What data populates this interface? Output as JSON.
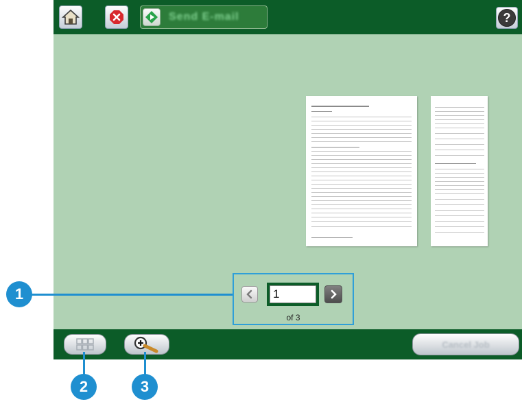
{
  "toolbar": {
    "home_icon": "home-icon",
    "stop_icon": "stop-icon",
    "send_label": "Send E-mail",
    "help_label": "?"
  },
  "pager": {
    "prev_icon": "chevron-left-icon",
    "next_icon": "chevron-right-icon",
    "current_page": "1",
    "of_label": "of 3"
  },
  "footer": {
    "thumbnails_icon": "grid-icon",
    "zoom_icon": "zoom-in-icon",
    "cancel_label": "Cancel Job"
  },
  "callouts": [
    "1",
    "2",
    "3"
  ],
  "colors": {
    "bar_green": "#0c5c28",
    "preview_bg": "#b0d2b4",
    "callout_blue": "#1f8fd0"
  }
}
